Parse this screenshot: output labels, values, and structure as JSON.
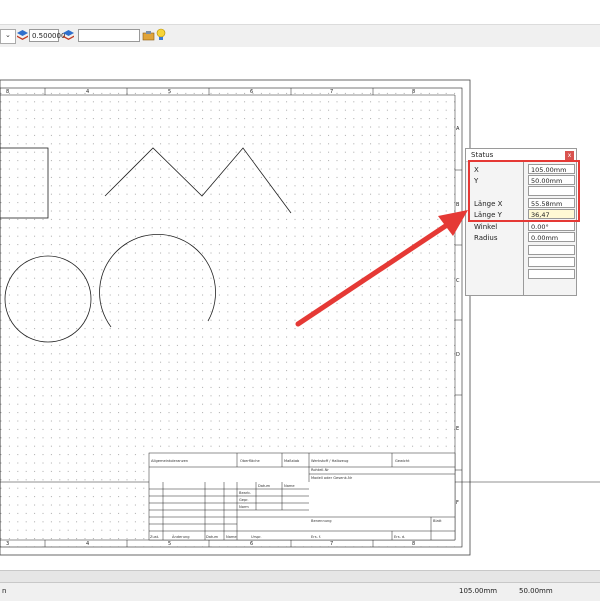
{
  "toolbar": {
    "scale_value": "0.500000",
    "text_value": "",
    "dropdown_icon": "chevron-down-icon",
    "layer_icon": "layers-icon",
    "tools_icon": "tools-icon",
    "bulb_icon": "lightbulb-icon"
  },
  "drawing": {
    "border_numbers_top": [
      "8",
      "4",
      "5",
      "6",
      "7",
      "8"
    ],
    "border_numbers_bottom": [
      "3",
      "4",
      "5",
      "6",
      "7",
      "8"
    ],
    "border_letters_right": [
      "A",
      "B",
      "C",
      "D",
      "E",
      "F"
    ],
    "title_block": {
      "row1": [
        "Allgemeintoleranzen",
        "Oberfläche",
        "Maßstab",
        "Gewicht",
        "Werkstoff / Halbzeug",
        "Rohteil-Nr",
        "Modell oder Gesenk-Nr"
      ],
      "row2": [
        "Datum",
        "Name",
        "Bearb.",
        "Gepr.",
        "Norm"
      ],
      "row3": [
        "Benennung",
        "Blatt"
      ],
      "row4": [
        "Zust.",
        "Änderung",
        "Datum",
        "Name",
        "Urspr.",
        "Ers. f.",
        "Ers. d."
      ]
    }
  },
  "status_panel": {
    "title": "Status",
    "close_label": "x",
    "rows": [
      {
        "label": "X",
        "value": "105.00mm"
      },
      {
        "label": "Y",
        "value": "50.00mm"
      },
      {
        "label": "",
        "value": ""
      },
      {
        "label": "Länge X",
        "value": "55.58mm"
      },
      {
        "label": "Länge Y",
        "value": "36,47"
      },
      {
        "label": "Winkel",
        "value": "0.00°"
      },
      {
        "label": "Radius",
        "value": "0.00mm"
      },
      {
        "label": "",
        "value": ""
      },
      {
        "label": "",
        "value": ""
      },
      {
        "label": "",
        "value": ""
      }
    ]
  },
  "statusbar": {
    "left_text": "n",
    "x_value": "105.00mm",
    "y_value": "50.00mm"
  },
  "colors": {
    "annotation": "#e53935",
    "highlight_field": "#fff9d4",
    "close_button": "#d9534f"
  }
}
